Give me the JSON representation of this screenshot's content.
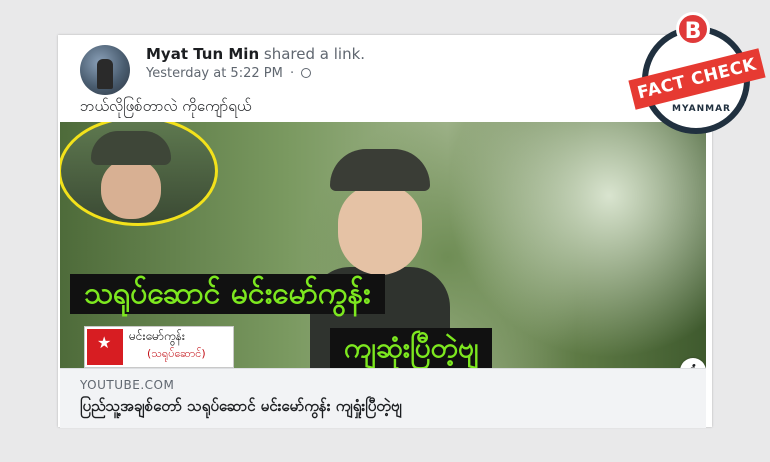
{
  "post": {
    "author": "Myat Tun Min",
    "action": "shared a link.",
    "timestamp": "Yesterday at 5:22 PM",
    "separator": "·",
    "caption": "ဘယ်လိုဖြစ်တာလဲ ကိုကျော်ရယ်"
  },
  "link": {
    "banner_top": "သရုပ်ဆောင် မင်းမော်ကွန်း",
    "banner_bottom": "ကျဆုံးပြီတဲ့ဗျ",
    "logo_line1": "မင်းမော်ကွန်း",
    "logo_line2": "(သရုပ်ဆောင်)",
    "domain": "YOUTUBE.COM",
    "title": "ပြည်သူ့အချစ်တော် သရုပ်ဆောင် မင်းမော်ကွန်း ကျရှုံးပြီတဲ့ဗျ"
  },
  "badge": {
    "letter": "B",
    "label": "FACT CHECK",
    "sub": "MYANMAR"
  },
  "icons": {
    "globe": "globe-icon",
    "info": "info-icon",
    "star": "star-icon"
  },
  "colors": {
    "banner_text": "#7de81f",
    "badge_red": "#e63a32",
    "badge_navy": "#20303f"
  }
}
